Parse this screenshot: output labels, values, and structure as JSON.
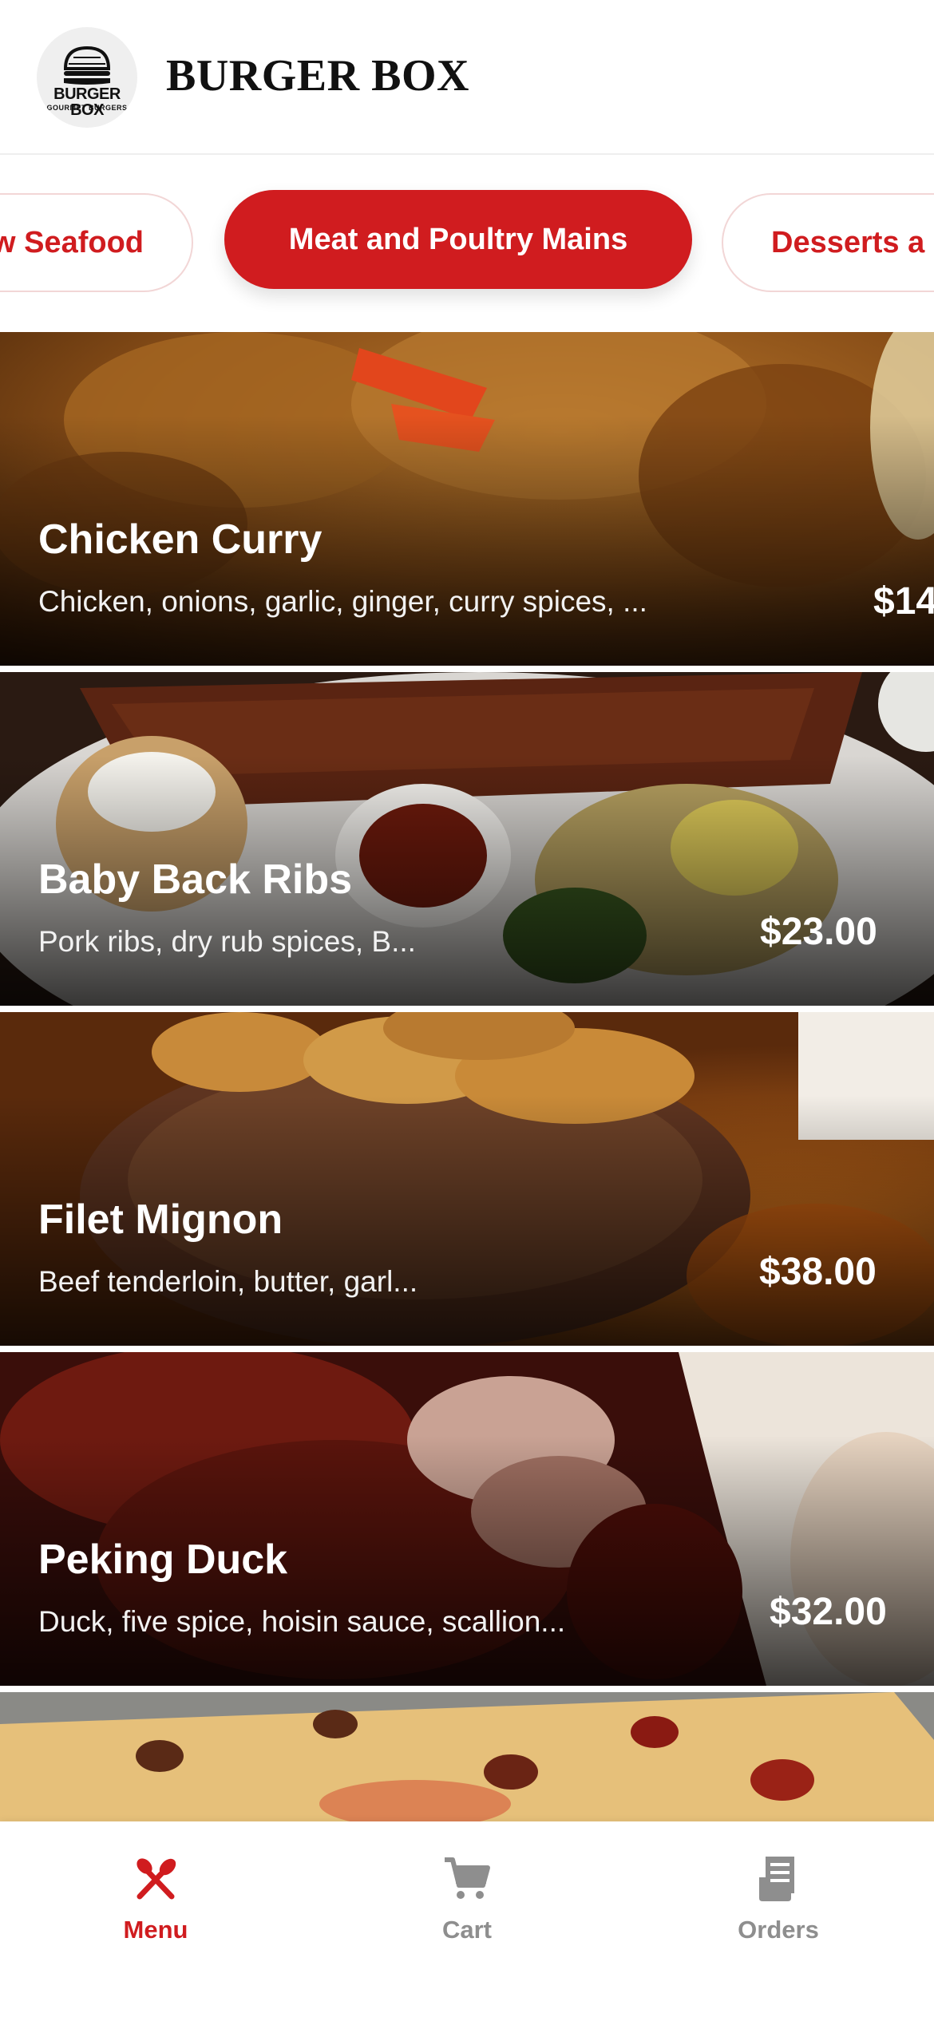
{
  "header": {
    "logo_text": "BURGER BOX",
    "logo_subtext": "GOURMET BURGERS",
    "brand_name": "BURGER BOX"
  },
  "categories": {
    "items": [
      {
        "label": "w Seafood",
        "active": false
      },
      {
        "label": "Meat and Poultry Mains",
        "active": true
      },
      {
        "label": "Desserts a",
        "active": false
      }
    ]
  },
  "dishes": [
    {
      "name": "Chicken Curry",
      "description": "Chicken, onions, garlic, ginger, curry spices, ...",
      "price": "$14"
    },
    {
      "name": "Baby Back Ribs",
      "description": "Pork ribs, dry rub spices, B...",
      "price": "$23.00"
    },
    {
      "name": "Filet Mignon",
      "description": "Beef tenderloin, butter, garl...",
      "price": "$38.00"
    },
    {
      "name": "Peking Duck",
      "description": "Duck, five spice, hoisin sauce, scallion...",
      "price": "$32.00"
    },
    {
      "name": "",
      "description": "",
      "price": ""
    }
  ],
  "bottom_nav": {
    "items": [
      {
        "label": "Menu",
        "icon": "fork-knife-icon",
        "active": true
      },
      {
        "label": "Cart",
        "icon": "cart-icon",
        "active": false
      },
      {
        "label": "Orders",
        "icon": "receipt-icon",
        "active": false
      }
    ]
  },
  "colors": {
    "accent": "#d01c1f",
    "inactive": "#8e8e8e",
    "background": "#ffffff"
  }
}
